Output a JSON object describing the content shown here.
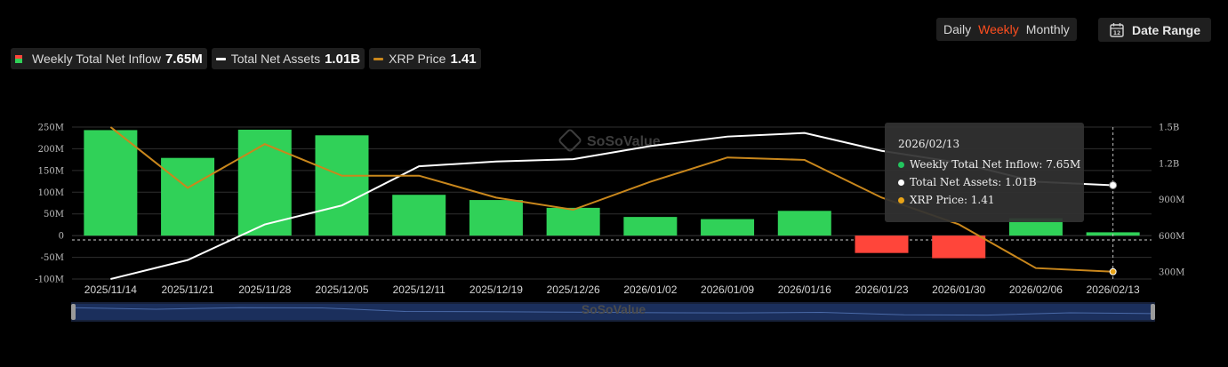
{
  "controls": {
    "periods": [
      {
        "label": "Daily",
        "active": false
      },
      {
        "label": "Weekly",
        "active": true
      },
      {
        "label": "Monthly",
        "active": false
      }
    ],
    "date_range_label": "Date Range"
  },
  "legend": [
    {
      "label": "Weekly Total Net Inflow",
      "value": "7.65M"
    },
    {
      "label": "Total Net Assets",
      "value": "1.01B"
    },
    {
      "label": "XRP Price",
      "value": "1.41"
    }
  ],
  "watermark": "SoSoValue",
  "tooltip": {
    "date": "2026/02/13",
    "rows": [
      {
        "label": "Weekly Total Net Inflow: 7.65M",
        "color": "#22c55e"
      },
      {
        "label": "Total Net Assets: 1.01B",
        "color": "#ffffff"
      },
      {
        "label": "XRP Price: 1.41",
        "color": "#e8a317"
      }
    ]
  },
  "colors": {
    "positive": "#30d158",
    "negative": "#ff453a",
    "assets_line": "#ffffff",
    "price_line": "#c9871c",
    "grid": "#2f2f2f"
  },
  "chart_data": {
    "type": "bar",
    "categories": [
      "2025/11/14",
      "2025/11/21",
      "2025/11/28",
      "2025/12/05",
      "2025/12/11",
      "2025/12/19",
      "2025/12/26",
      "2026/01/02",
      "2026/01/09",
      "2026/01/16",
      "2026/01/23",
      "2026/01/30",
      "2026/02/06",
      "2026/02/13"
    ],
    "left_axis": {
      "ticks": [
        "250M",
        "200M",
        "150M",
        "100M",
        "50M",
        "0",
        "-50M",
        "-100M"
      ],
      "range": [
        -100,
        250
      ]
    },
    "right_axis": {
      "ticks": [
        "1.5B",
        "1.2B",
        "900M",
        "600M",
        "300M"
      ],
      "range": [
        220,
        1500
      ]
    },
    "price_range": [
      1.35,
      2.6
    ],
    "series": [
      {
        "name": "Weekly Total Net Inflow",
        "type": "bar",
        "axis": "left",
        "unit": "M",
        "values": [
          243,
          179,
          244,
          231,
          94,
          82,
          64,
          43,
          38,
          57,
          -40,
          -52,
          40,
          7.65
        ]
      },
      {
        "name": "Total Net Assets",
        "type": "line",
        "axis": "right",
        "unit": "M",
        "values": [
          220,
          380,
          680,
          840,
          1170,
          1210,
          1230,
          1340,
          1420,
          1450,
          1300,
          1200,
          1040,
          1010
        ]
      },
      {
        "name": "XRP Price",
        "type": "line",
        "axis": "price",
        "values": [
          2.6,
          2.1,
          2.46,
          2.2,
          2.2,
          2.02,
          1.92,
          2.15,
          2.35,
          2.33,
          2.02,
          1.8,
          1.44,
          1.41
        ]
      }
    ],
    "grid": true,
    "legend_position": "top-left"
  }
}
